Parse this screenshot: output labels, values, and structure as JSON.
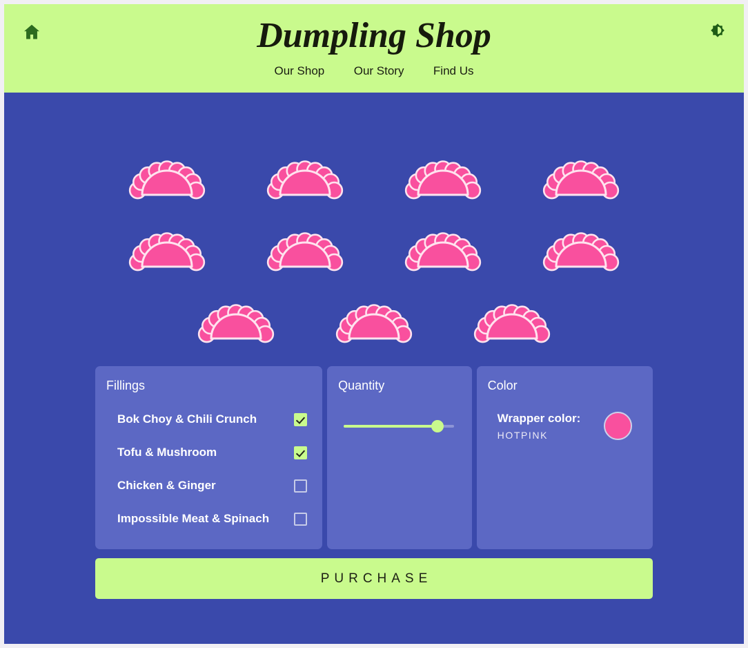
{
  "header": {
    "title": "Dumpling Shop",
    "home_icon": "home-icon",
    "theme_icon": "brightness-toggle-icon",
    "nav": [
      {
        "label": "Our Shop"
      },
      {
        "label": "Our Story"
      },
      {
        "label": "Find Us"
      }
    ]
  },
  "stage": {
    "dumpling_count": 11,
    "rows": [
      4,
      4,
      3
    ],
    "dumpling_color": "#f9509e",
    "dumpling_outline": "#ffe3ef"
  },
  "controls": {
    "fillings": {
      "title": "Fillings",
      "items": [
        {
          "label": "Bok Choy & Chili Crunch",
          "checked": true
        },
        {
          "label": "Tofu & Mushroom",
          "checked": true
        },
        {
          "label": "Chicken & Ginger",
          "checked": false
        },
        {
          "label": "Impossible Meat & Spinach",
          "checked": false
        }
      ]
    },
    "quantity": {
      "title": "Quantity",
      "value_percent": 85
    },
    "color": {
      "title": "Color",
      "wrapper_label": "Wrapper color:",
      "wrapper_value": "HOTPINK",
      "swatch_color": "#f9509e"
    }
  },
  "purchase": {
    "label": "PURCHASE"
  },
  "theme": {
    "page_background": "#3a49ab",
    "header_background": "#c9fa8d",
    "panel_background": "#5c68c4",
    "accent_green": "#c9fa8d",
    "outer_margin": "#f1eff4"
  }
}
